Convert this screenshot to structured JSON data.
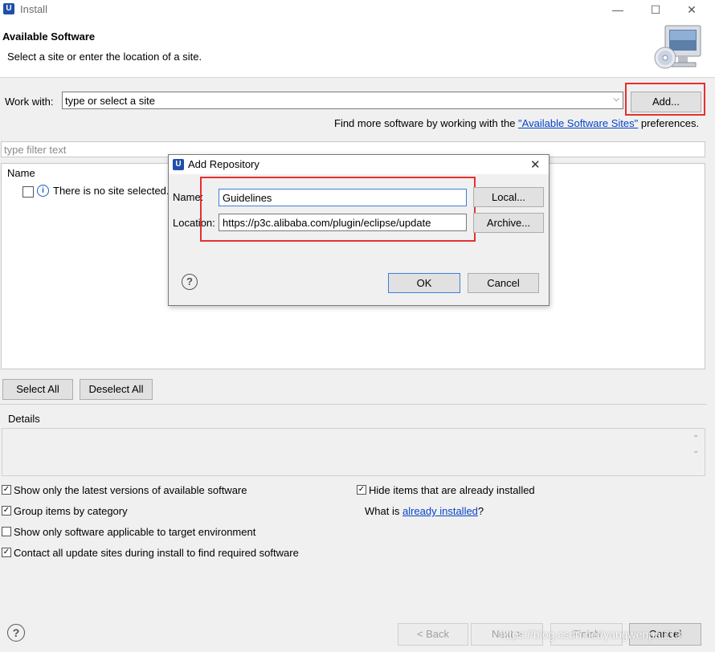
{
  "window": {
    "title": "Install",
    "minimize": "—",
    "maximize": "☐",
    "close": "✕",
    "app_icon_letter": "U"
  },
  "header": {
    "title": "Available Software",
    "subtitle": "Select a site or enter the location of a site."
  },
  "work_with": {
    "label": "Work with:",
    "placeholder": "type or select a site",
    "add_button": "Add...",
    "find_more_prefix": "Find more software by working with the ",
    "find_more_link": "\"Available Software Sites\"",
    "find_more_suffix": " preferences."
  },
  "filter": {
    "placeholder": "type filter text"
  },
  "list": {
    "column_name": "Name",
    "rows": [
      {
        "text": "There is no site selected.",
        "checked": false
      }
    ]
  },
  "buttons": {
    "select_all": "Select All",
    "deselect_all": "Deselect All"
  },
  "details": {
    "label": "Details"
  },
  "options": {
    "latest_versions": {
      "label": "Show only the latest versions of available software",
      "checked": true
    },
    "group_by_category": {
      "label": "Group items by category",
      "checked": true
    },
    "applicable_only": {
      "label": "Show only software applicable to target environment",
      "checked": false
    },
    "contact_sites": {
      "label": "Contact all update sites during install to find required software",
      "checked": true
    },
    "hide_installed": {
      "label": "Hide items that are already installed",
      "checked": true
    },
    "what_is_prefix": "What is ",
    "what_is_link": "already installed",
    "what_is_suffix": "?"
  },
  "footer": {
    "back": "< Back",
    "next": "Next >",
    "finish": "Finish",
    "cancel": "Cancel",
    "watermark": "https://blog.csdn.net/yangwenpai113"
  },
  "dialog": {
    "title": "Add Repository",
    "name_label": "Name:",
    "name_value": "Guidelines",
    "location_label": "Location:",
    "location_value": "https://p3c.alibaba.com/plugin/eclipse/update",
    "local_button": "Local...",
    "archive_button": "Archive...",
    "ok": "OK",
    "cancel": "Cancel"
  },
  "colors": {
    "highlight_box": "#e53030",
    "link": "#0645c8",
    "focus_border": "#3c7fd6"
  }
}
